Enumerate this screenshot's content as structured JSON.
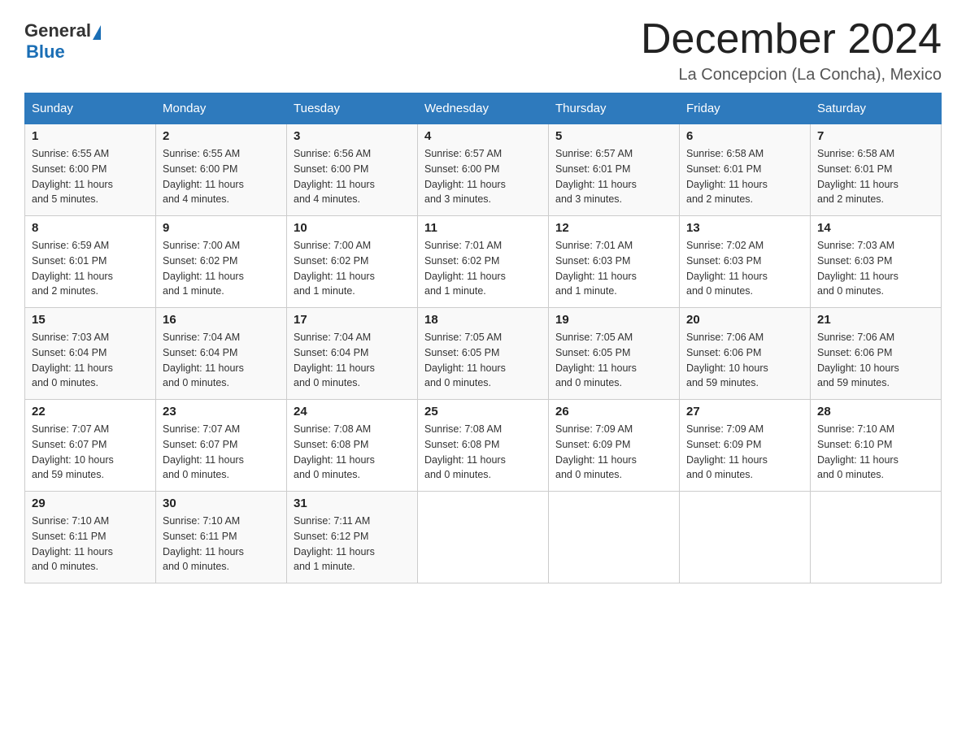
{
  "header": {
    "logo_general": "General",
    "logo_blue": "Blue",
    "month_title": "December 2024",
    "subtitle": "La Concepcion (La Concha), Mexico"
  },
  "days_of_week": [
    "Sunday",
    "Monday",
    "Tuesday",
    "Wednesday",
    "Thursday",
    "Friday",
    "Saturday"
  ],
  "weeks": [
    [
      {
        "day": "1",
        "info": "Sunrise: 6:55 AM\nSunset: 6:00 PM\nDaylight: 11 hours\nand 5 minutes."
      },
      {
        "day": "2",
        "info": "Sunrise: 6:55 AM\nSunset: 6:00 PM\nDaylight: 11 hours\nand 4 minutes."
      },
      {
        "day": "3",
        "info": "Sunrise: 6:56 AM\nSunset: 6:00 PM\nDaylight: 11 hours\nand 4 minutes."
      },
      {
        "day": "4",
        "info": "Sunrise: 6:57 AM\nSunset: 6:00 PM\nDaylight: 11 hours\nand 3 minutes."
      },
      {
        "day": "5",
        "info": "Sunrise: 6:57 AM\nSunset: 6:01 PM\nDaylight: 11 hours\nand 3 minutes."
      },
      {
        "day": "6",
        "info": "Sunrise: 6:58 AM\nSunset: 6:01 PM\nDaylight: 11 hours\nand 2 minutes."
      },
      {
        "day": "7",
        "info": "Sunrise: 6:58 AM\nSunset: 6:01 PM\nDaylight: 11 hours\nand 2 minutes."
      }
    ],
    [
      {
        "day": "8",
        "info": "Sunrise: 6:59 AM\nSunset: 6:01 PM\nDaylight: 11 hours\nand 2 minutes."
      },
      {
        "day": "9",
        "info": "Sunrise: 7:00 AM\nSunset: 6:02 PM\nDaylight: 11 hours\nand 1 minute."
      },
      {
        "day": "10",
        "info": "Sunrise: 7:00 AM\nSunset: 6:02 PM\nDaylight: 11 hours\nand 1 minute."
      },
      {
        "day": "11",
        "info": "Sunrise: 7:01 AM\nSunset: 6:02 PM\nDaylight: 11 hours\nand 1 minute."
      },
      {
        "day": "12",
        "info": "Sunrise: 7:01 AM\nSunset: 6:03 PM\nDaylight: 11 hours\nand 1 minute."
      },
      {
        "day": "13",
        "info": "Sunrise: 7:02 AM\nSunset: 6:03 PM\nDaylight: 11 hours\nand 0 minutes."
      },
      {
        "day": "14",
        "info": "Sunrise: 7:03 AM\nSunset: 6:03 PM\nDaylight: 11 hours\nand 0 minutes."
      }
    ],
    [
      {
        "day": "15",
        "info": "Sunrise: 7:03 AM\nSunset: 6:04 PM\nDaylight: 11 hours\nand 0 minutes."
      },
      {
        "day": "16",
        "info": "Sunrise: 7:04 AM\nSunset: 6:04 PM\nDaylight: 11 hours\nand 0 minutes."
      },
      {
        "day": "17",
        "info": "Sunrise: 7:04 AM\nSunset: 6:04 PM\nDaylight: 11 hours\nand 0 minutes."
      },
      {
        "day": "18",
        "info": "Sunrise: 7:05 AM\nSunset: 6:05 PM\nDaylight: 11 hours\nand 0 minutes."
      },
      {
        "day": "19",
        "info": "Sunrise: 7:05 AM\nSunset: 6:05 PM\nDaylight: 11 hours\nand 0 minutes."
      },
      {
        "day": "20",
        "info": "Sunrise: 7:06 AM\nSunset: 6:06 PM\nDaylight: 10 hours\nand 59 minutes."
      },
      {
        "day": "21",
        "info": "Sunrise: 7:06 AM\nSunset: 6:06 PM\nDaylight: 10 hours\nand 59 minutes."
      }
    ],
    [
      {
        "day": "22",
        "info": "Sunrise: 7:07 AM\nSunset: 6:07 PM\nDaylight: 10 hours\nand 59 minutes."
      },
      {
        "day": "23",
        "info": "Sunrise: 7:07 AM\nSunset: 6:07 PM\nDaylight: 11 hours\nand 0 minutes."
      },
      {
        "day": "24",
        "info": "Sunrise: 7:08 AM\nSunset: 6:08 PM\nDaylight: 11 hours\nand 0 minutes."
      },
      {
        "day": "25",
        "info": "Sunrise: 7:08 AM\nSunset: 6:08 PM\nDaylight: 11 hours\nand 0 minutes."
      },
      {
        "day": "26",
        "info": "Sunrise: 7:09 AM\nSunset: 6:09 PM\nDaylight: 11 hours\nand 0 minutes."
      },
      {
        "day": "27",
        "info": "Sunrise: 7:09 AM\nSunset: 6:09 PM\nDaylight: 11 hours\nand 0 minutes."
      },
      {
        "day": "28",
        "info": "Sunrise: 7:10 AM\nSunset: 6:10 PM\nDaylight: 11 hours\nand 0 minutes."
      }
    ],
    [
      {
        "day": "29",
        "info": "Sunrise: 7:10 AM\nSunset: 6:11 PM\nDaylight: 11 hours\nand 0 minutes."
      },
      {
        "day": "30",
        "info": "Sunrise: 7:10 AM\nSunset: 6:11 PM\nDaylight: 11 hours\nand 0 minutes."
      },
      {
        "day": "31",
        "info": "Sunrise: 7:11 AM\nSunset: 6:12 PM\nDaylight: 11 hours\nand 1 minute."
      },
      {
        "day": "",
        "info": ""
      },
      {
        "day": "",
        "info": ""
      },
      {
        "day": "",
        "info": ""
      },
      {
        "day": "",
        "info": ""
      }
    ]
  ]
}
